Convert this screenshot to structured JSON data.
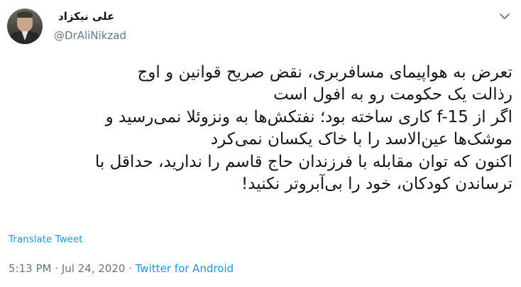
{
  "tweet": {
    "author_name": "علی نیکزاد",
    "author_handle": "@DrAliNikzad",
    "body_lines": [
      "تعرض به هواپیمای مسافربری، نقض صریح قوانین و اوج",
      "رذالت یک حکومت رو به افول است",
      "اگر از f-15 کاری ساخته بود؛ نفتکش‌ها به ونزوئلا نمی‌رسید و",
      "موشک‌ها عین‌الاسد را با خاک یکسان نمی‌کرد",
      "اکنون که توان مقابله با فرزندان حاج قاسم را ندارید، حداقل با",
      "ترساندن کودکان، خود را بی‌آبروتر نکنید!"
    ],
    "translate_label": "Translate Tweet",
    "time": "5:13 PM",
    "separator": " · ",
    "date": "Jul 24, 2020",
    "source": "Twitter for Android"
  },
  "icons": {
    "avatar": "profile-photo",
    "menu": "chevron-down-icon"
  },
  "colors": {
    "text": "#14171a",
    "secondary": "#657786",
    "link": "#1b95e0"
  }
}
